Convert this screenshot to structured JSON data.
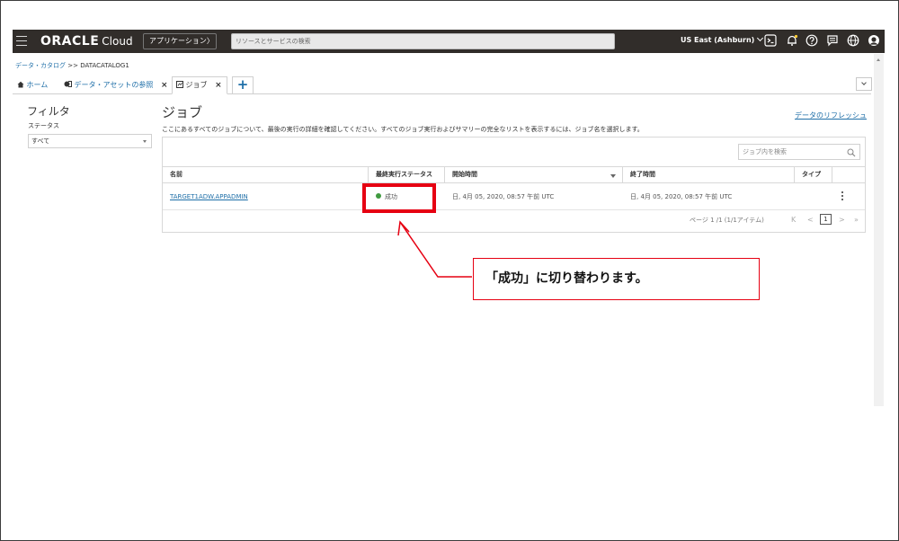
{
  "topbar": {
    "brand_bold": "ORACLE",
    "brand_light": "Cloud",
    "apps_label": "アプリケーション〉",
    "search_placeholder": "リソースとサービスの検索",
    "region_label": "US East (Ashburn)",
    "icons": [
      "menu-icon",
      "cloud-shell-icon",
      "bell-icon",
      "help-icon",
      "chat-icon",
      "globe-icon",
      "user-icon"
    ]
  },
  "breadcrumb": {
    "parent": "データ・カタログ",
    "separator": ">>",
    "current": "DATACATALOG1"
  },
  "tabs": [
    {
      "label": "ホーム",
      "icon": "home-icon"
    },
    {
      "label": "データ・アセットの参照",
      "icon": "asset-icon",
      "close": "×"
    },
    {
      "label": "ジョブ",
      "icon": "job-icon",
      "close": "×"
    }
  ],
  "add_tab_label": "+",
  "filter": {
    "title": "フィルタ",
    "status_label": "ステータス",
    "status_value": "すべて"
  },
  "main": {
    "title": "ジョブ",
    "refresh_label": "データのリフレッシュ",
    "description": "ここにあるすべてのジョブについて、最後の実行の詳細を確認してください。すべてのジョブ実行およびサマリーの完全なリストを表示するには、ジョブ名を選択します。",
    "search_placeholder": "ジョブ内を検索"
  },
  "table": {
    "columns": [
      "名前",
      "最終実行ステータス",
      "開始時間",
      "終了時間",
      "タイプ"
    ],
    "rows": [
      {
        "name": "TARGET1ADW.APPADMIN",
        "status": "成功",
        "start": "日, 4月 05, 2020, 08:57 午前 UTC",
        "end": "日, 4月 05, 2020, 08:57 午前 UTC",
        "type": ""
      }
    ],
    "pager_text": "ページ 1 /1 (1/1アイテム)",
    "pager_first": "K",
    "pager_prev": "<",
    "pager_current": "1",
    "pager_next": ">",
    "pager_last": "»"
  },
  "annotation": {
    "text": "「成功」に切り替わります。",
    "color": "#e60012"
  },
  "colors": {
    "topbar": "#312d2a",
    "link": "#1f6fa8",
    "success": "#3f9a3f"
  }
}
